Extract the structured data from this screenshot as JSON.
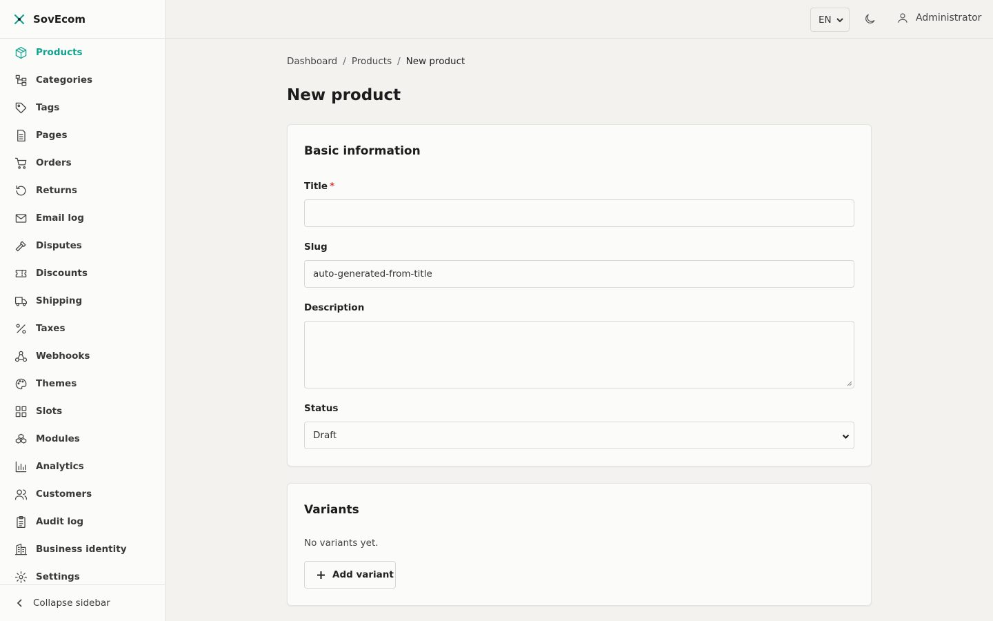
{
  "brand": {
    "name": "SovEcom",
    "accent": "#12a38f"
  },
  "sidebar": {
    "items": [
      {
        "label": "Products",
        "icon": "box-icon",
        "active": true
      },
      {
        "label": "Categories",
        "icon": "hierarchy-icon"
      },
      {
        "label": "Tags",
        "icon": "tag-icon"
      },
      {
        "label": "Pages",
        "icon": "page-icon"
      },
      {
        "label": "Orders",
        "icon": "cart-icon"
      },
      {
        "label": "Returns",
        "icon": "return-icon"
      },
      {
        "label": "Email log",
        "icon": "mail-icon"
      },
      {
        "label": "Disputes",
        "icon": "gavel-icon"
      },
      {
        "label": "Discounts",
        "icon": "ticket-icon"
      },
      {
        "label": "Shipping",
        "icon": "truck-icon"
      },
      {
        "label": "Taxes",
        "icon": "percent-icon"
      },
      {
        "label": "Webhooks",
        "icon": "webhook-icon"
      },
      {
        "label": "Themes",
        "icon": "palette-icon"
      },
      {
        "label": "Slots",
        "icon": "grid-icon"
      },
      {
        "label": "Modules",
        "icon": "modules-icon"
      },
      {
        "label": "Analytics",
        "icon": "chart-icon"
      },
      {
        "label": "Customers",
        "icon": "users-icon"
      },
      {
        "label": "Audit log",
        "icon": "clipboard-icon"
      },
      {
        "label": "Business identity",
        "icon": "building-icon"
      },
      {
        "label": "Settings",
        "icon": "gear-icon"
      }
    ],
    "collapse_label": "Collapse sidebar"
  },
  "topbar": {
    "language": "EN",
    "user": "Administrator"
  },
  "breadcrumb": [
    "Dashboard",
    "Products",
    "New product"
  ],
  "page_title": "New product",
  "basic_info": {
    "heading": "Basic information",
    "title_label": "Title",
    "title_required_marker": "*",
    "title_value": "",
    "slug_label": "Slug",
    "slug_placeholder": "auto-generated-from-title",
    "description_label": "Description",
    "description_value": "",
    "status_label": "Status",
    "status_value": "Draft"
  },
  "variants": {
    "heading": "Variants",
    "empty_text": "No variants yet.",
    "add_label": "Add variant"
  }
}
